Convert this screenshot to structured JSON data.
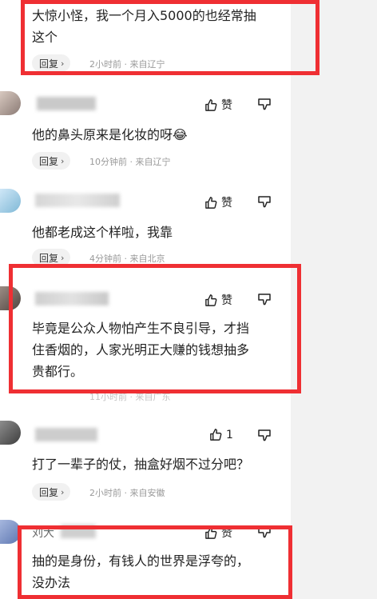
{
  "comments": [
    {
      "text_lines": [
        "大惊小怪，我一个月入5000的也经常抽",
        "这个"
      ],
      "reply_label": "回复",
      "time": "2小时前",
      "location": "来自辽宁"
    },
    {
      "text": "他的鼻头原来是化妆的呀",
      "emoji": "😂",
      "reply_label": "回复",
      "time": "10分钟前",
      "location": "来自辽宁",
      "like_label": "赞"
    },
    {
      "text": "他都老成这个样啦，我靠",
      "reply_label": "回复",
      "time": "4分钟前",
      "location": "来自北京",
      "like_label": "赞"
    },
    {
      "text_lines": [
        "毕竟是公众人物怕产生不良引导，才挡",
        "住香烟的，人家光明正大赚的钱想抽多",
        "贵都行。"
      ],
      "meta_partial": "11小时前 · 来自广东",
      "like_label": "赞"
    },
    {
      "text": "打了一辈子的仗，抽盒好烟不过分吧？",
      "reply_label": "回复",
      "time": "2小时前",
      "location": "来自安徽",
      "like_count": "1"
    },
    {
      "name_partial": "刘大",
      "text_lines": [
        "抽的是身份，有钱人的世界是浮夸的，",
        "没办法"
      ],
      "like_label": "赞"
    }
  ],
  "meta_separator": "·",
  "colors": {
    "highlight": "#ef2f33",
    "reply_bg": "#f1f1f1",
    "meta_text": "#9a9a9a",
    "side_strip": "#f2f2f2"
  }
}
